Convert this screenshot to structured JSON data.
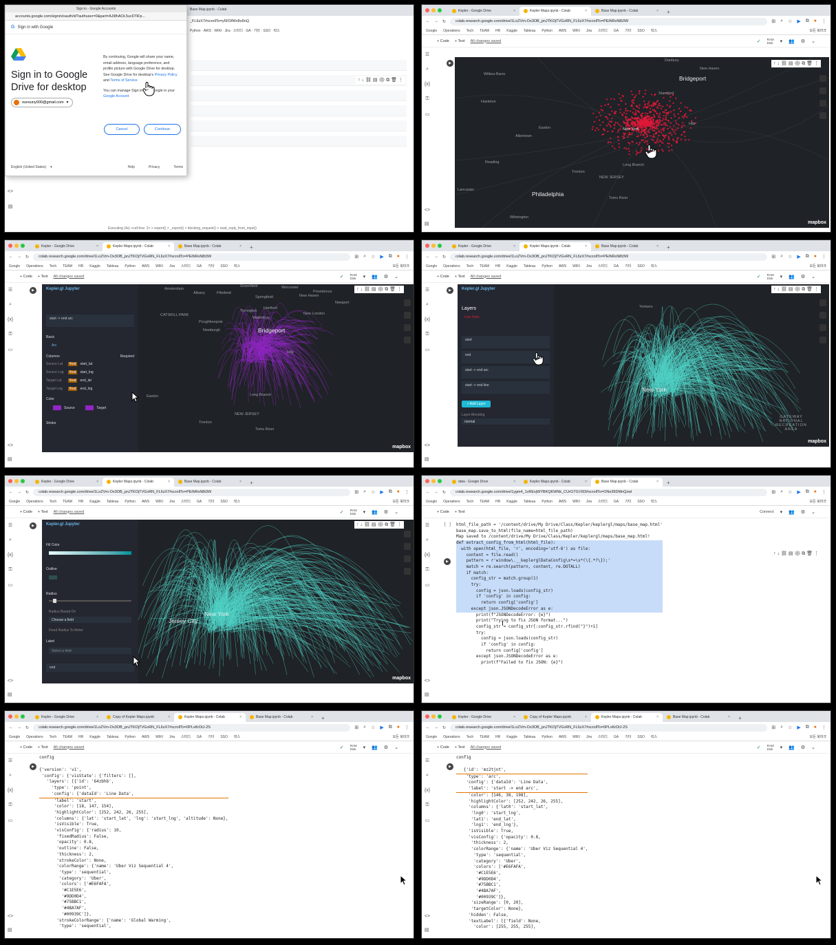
{
  "p1": {
    "dialog": {
      "window_title": "Sign in - Google Accounts",
      "url": "accounts.google.com/signin/oauth/id?authuser=0&part=AJi8hAOL5ucDTiFp...",
      "sign_in_with": "Sign in with Google",
      "heading_line1": "Sign in to Google",
      "heading_line2": "Drive for desktop",
      "account": "eunsuny000@gmail.com",
      "text1": "By continuing, Google will share your name, email address, language preference, and profile picture with Google Drive for desktop. See Google Drive for desktop's",
      "privacy": "Privacy Policy",
      "and": "and",
      "terms": "Terms of Service",
      "text2": "You can manage Sign in with Google in your",
      "google_account": "Google Account",
      "cancel": "Cancel",
      "continue": "Continue",
      "language": "English (United States)",
      "help": "Help",
      "privacy_link": "Privacy",
      "terms_link": "Terms"
    },
    "bg_tab": "Base Map.ipynb - Colab",
    "bg_url": "_FL6zX7#scrollTo=y5FDfWv8o9nQ",
    "footer": "Executing (4s) <cell line: 2> > export() > _export() > blocking_request() > read_reply_from_input()"
  },
  "tabs_a": [
    "Kepler - Google Drive",
    "Kepler Maps.ipynb - Colab",
    "Base Map.ipynb - Colab"
  ],
  "tabs_b": [
    "data - Google Drive",
    "Kepler Maps.ipynb - Colab",
    "Base Map.ipynb - Colab"
  ],
  "tabs_c": [
    "Kepler - Google Drive",
    "Copy of Kepler Maps.ipynb",
    "Kepler Maps.ipynb - Colab",
    "Base Map.ipynb - Colab"
  ],
  "url_a": "colab.research.google.com/drive/1LoZVm-Ox3OB_pnJTKOjTVGvRN_FL6zX7#scrollTo=PEiNRxN8t3W",
  "url_b": "colab.research.google.com/drive/1ygm4_1vRExjWYBKQKWNk_CUrGTGVI93#scrollTo=ONe39DMnQzwl",
  "url_c": "colab.research.google.com/drive/1LoZVm-Ox3OB_pnJTKOjTVGvRN_FL6zX7#scrollTo=0PLxKrDtJ-2S",
  "bookmarks": [
    "Google",
    "Operations",
    "Tech",
    "TEAM",
    "HR",
    "Kaggle",
    "Tableau",
    "Python",
    "AWS",
    "WIKI",
    "Jira",
    "스터디",
    "GA",
    "기타",
    "SSO",
    "럭스"
  ],
  "all_bookmarks": "모든 북마크",
  "toolbar": {
    "code": "+ Code",
    "text": "+ Text",
    "saved": "All changes saved",
    "ram": "RAM",
    "disk": "Disk",
    "connect": "Connect"
  },
  "map2": {
    "labels": [
      "Danbury",
      "New Haven",
      "Wilkes-Barre",
      "Bridgeport",
      "Stamford",
      "Hazleton",
      "Easton",
      "Allentown",
      "New York",
      "Hilp",
      "Reading",
      "Long Branch",
      "Trenton",
      "NEW JERSEY",
      "Lancaster",
      "Philadelphia",
      "Toms River",
      "Wilmington"
    ],
    "mapbox": "mapbox"
  },
  "map3": {
    "panel_title": "Kepler.gl Jupyter",
    "layer": "start -> end arc",
    "basic": "Basic",
    "arc": "Arc",
    "columns": "Columns",
    "required": "Required",
    "fields": [
      [
        "Source Lat",
        "start_lat"
      ],
      [
        "Source Lng",
        "start_lng"
      ],
      [
        "Target Lat",
        "end_lat"
      ],
      [
        "Target Lng",
        "end_lng"
      ]
    ],
    "color": "Color",
    "source": "Source",
    "target": "Target",
    "stroke": "Stroke",
    "labels": [
      "Amsterdam",
      "Albany",
      "Pittsfield",
      "Greenfield",
      "Worcester",
      "Providence",
      "Springfield",
      "Hartford",
      "New Haven",
      "Newport",
      "CATSKILL PARK",
      "Torrington",
      "Waterbury",
      "New London",
      "Poughkeepsie",
      "Newburgh",
      "Bridgeport",
      "Islip",
      "Easton",
      "Long Branch",
      "NEW JERSEY",
      "Trenton",
      "Toms River"
    ]
  },
  "map4": {
    "panel_title": "Kepler.gl Jupyter",
    "layers": "Layers",
    "dataset": "Line Data",
    "items": [
      "start",
      "end",
      "start -> end arc",
      "start -> end line"
    ],
    "add_layer": "+ Add Layer",
    "blending": "Layer Blending",
    "blend_mode": "normal",
    "labels": [
      "Yonkers",
      "New York",
      "GATEWAY NATIONAL RECREATION AREA"
    ]
  },
  "map5": {
    "panel_title": "Kepler.gl Jupyter",
    "fill_color": "Fill Color",
    "outline": "Outline",
    "radius": "Radius",
    "radius_based_on": "Radius Based On",
    "radius_field": "Choose a field",
    "fixed": "Fixed Radius To Meter",
    "label": "Label",
    "select_field": "Select a field",
    "end": "end",
    "labels": [
      "Jersey City",
      "New York"
    ]
  },
  "code6": {
    "lines": [
      "html_file_path = '/content/drive/My Drive/Class/Kepler/keplergl/maps/base_map.html'",
      "base_map.save_to_html(file_name=html_file_path)",
      "",
      "Map saved to /content/drive/My Drive/Class/Kepler/keplergl/maps/base_map.html!",
      "",
      "def extract_config_from_html(html_file):",
      "  with open(html_file, 'r', encoding='utf-8') as file:",
      "    content = file.read()",
      "    pattern = r'window\\.__keplerglDataConfig\\s*=\\s*(\\{.*?\\});'",
      "    match = re.search(pattern, content, re.DOTALL)",
      "    if match:",
      "      config_str = match.group(1)",
      "      try:",
      "        config = json.loads(config_str)",
      "        if 'config' in config:",
      "          return config['config']",
      "      except json.JSONDecodeError as e:",
      "        print(f\"JSONDecodeError: {e}\")",
      "        print(\"Trying to fix JSON format...\")",
      "        config_str = config_str[:config_str.rfind(\"}\")+1]",
      "        try:",
      "          config = json.loads(config_str)",
      "          if 'config' in config:",
      "            return config['config']",
      "        except json.JSONDecodeError as e:",
      "          print(f\"Failed to fix JSON: {e}\")"
    ]
  },
  "code7": {
    "header": "config",
    "lines": [
      "{'version': 'v1',",
      " 'config': {'visState': {'filters': [],",
      "   'layers': [{'id': '64zbhb',",
      "     'type': 'point',",
      "     'config': {'dataId': 'Line Data',",
      "      'label': 'start',",
      "      'color': [18, 147, 154],",
      "      'highlightColor': [252, 242, 26, 255],",
      "      'columns': {'lat': 'start_lat', 'lng': 'start_lng', 'altitude': None},",
      "      'isVisible': True,",
      "      'visConfig': {'radius': 10,",
      "       'fixedRadius': False,",
      "       'opacity': 0.8,",
      "       'outline': False,",
      "       'thickness': 2,",
      "       'strokeColor': None,",
      "       'colorRange': {'name': 'Uber Viz Sequential 4',",
      "        'type': 'sequential',",
      "        'category': 'Uber',",
      "        'colors': ['#E6FAFA',",
      "         '#C1E5E6',",
      "         '#9DD0D4',",
      "         '#75BBC1',",
      "         '#4BA7AF',",
      "         '#00939C']},",
      "       'strokeColorRange': {'name': 'Global Warming',",
      "        'type': 'sequential',"
    ]
  },
  "code8": {
    "header": "config",
    "lines": [
      "   {'id': 'mz2tjnt',",
      "    'type': 'arc',",
      "    'config': {'dataId': 'Line Data',",
      "     'label': 'start -> end arc',",
      "     'color': [146, 38, 198],",
      "     'highlightColor': [252, 242, 26, 255],",
      "     'columns': {'lat0': 'start_lat',",
      "      'lng0': 'start_lng',",
      "      'lat1': 'end_lat',",
      "      'lng1': 'end_lng'},",
      "     'isVisible': True,",
      "     'visConfig': {'opacity': 0.8,",
      "      'thickness': 2,",
      "      'colorRange': {'name': 'Uber Viz Sequential 4',",
      "       'type': 'sequential',",
      "       'category': 'Uber',",
      "       'colors': ['#E6FAFA',",
      "        '#C1E5E6',",
      "        '#9DD0D4',",
      "        '#75BBC1',",
      "        '#4BA7AF',",
      "        '#00939C']},",
      "      'sizeRange': [0, 20],",
      "      'targetColor': None},",
      "     'hidden': False,",
      "     'textLabel': [{'field': None,",
      "       'color': [255, 255, 255],"
    ]
  },
  "colors": {
    "point_red": "#e0193a",
    "arc_purple": "#9226c6",
    "arc_teal": "#4fd1c5",
    "map_bg": "#1f2226",
    "selection": "#c7dcf8"
  }
}
